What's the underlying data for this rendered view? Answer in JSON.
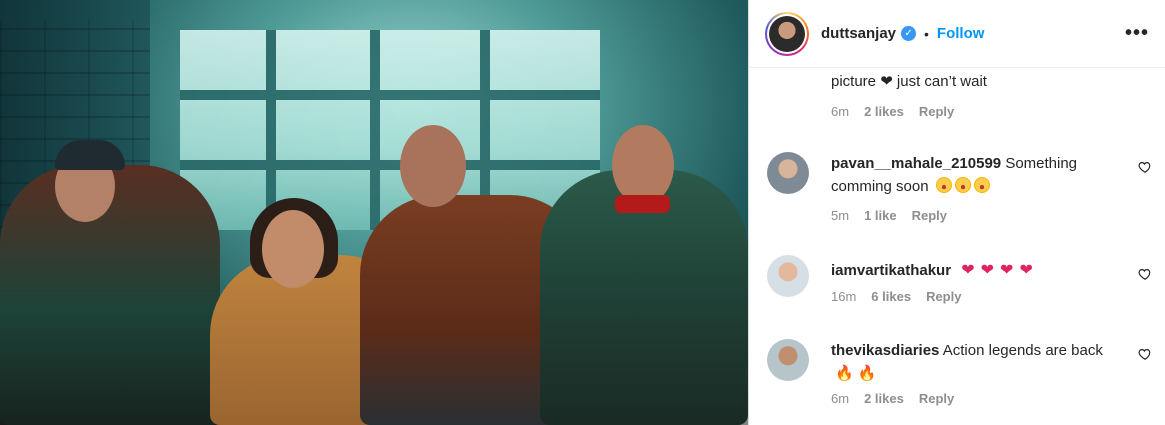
{
  "post": {
    "username": "duttsanjay",
    "verified_glyph": "✓",
    "separator": "•",
    "follow_label": "Follow",
    "more_glyph": "•••"
  },
  "previous_comment": {
    "text_tail": "picture ❤ just can’t wait",
    "time": "6m",
    "likes": "2 likes",
    "reply": "Reply"
  },
  "comments": [
    {
      "username": "pavan__mahale_210599",
      "text": "Something comming soon",
      "emojis": [
        "😮",
        "😮",
        "😮"
      ],
      "time": "5m",
      "likes": "1 like",
      "reply": "Reply"
    },
    {
      "username": "iamvartikathakur",
      "text": "",
      "emojis": [
        "❤️",
        "❤️",
        "❤️",
        "❤️"
      ],
      "time": "16m",
      "likes": "6 likes",
      "reply": "Reply"
    },
    {
      "username": "thevikasdiaries",
      "text": "Action legends are back",
      "emojis": [
        "🔥",
        "🔥"
      ],
      "time": "6m",
      "likes": "2 likes",
      "reply": "Reply"
    }
  ],
  "colors": {
    "follow": "#0095f6",
    "verified": "#3897f0",
    "muted": "#8e8e8e"
  },
  "icons": [
    "verified-badge-icon",
    "more-options-icon",
    "heart-outline-icon"
  ]
}
